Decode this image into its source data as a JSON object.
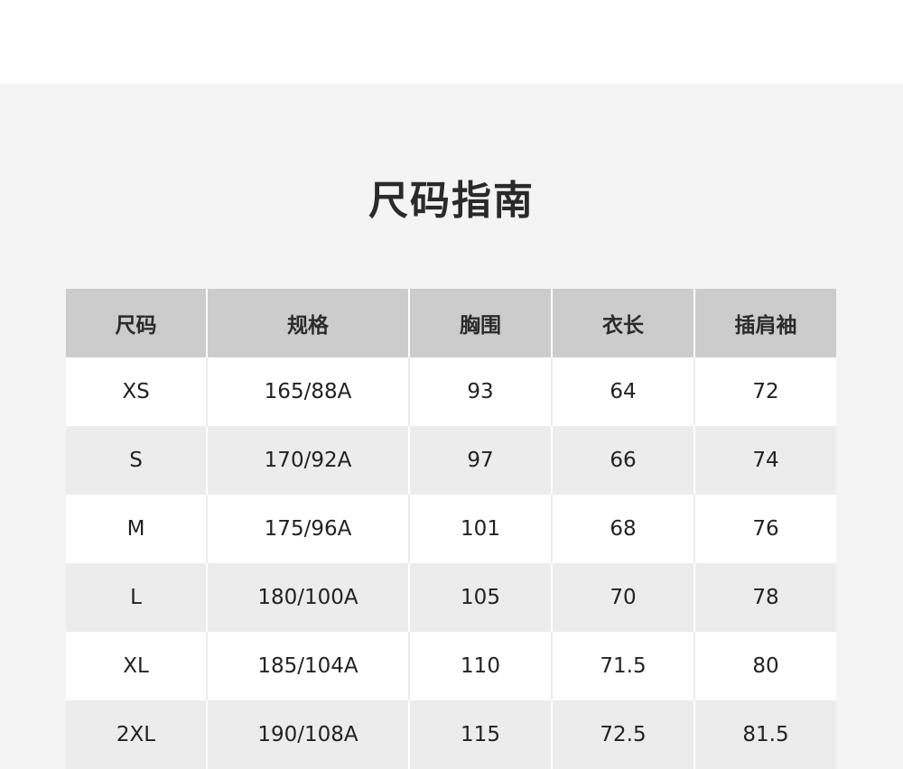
{
  "title": "尺码指南",
  "table": {
    "headers": [
      "尺码",
      "规格",
      "胸围",
      "衣长",
      "插肩袖"
    ],
    "rows": [
      [
        "XS",
        "165/88A",
        "93",
        "64",
        "72"
      ],
      [
        "S",
        "170/92A",
        "97",
        "66",
        "74"
      ],
      [
        "M",
        "175/96A",
        "101",
        "68",
        "76"
      ],
      [
        "L",
        "180/100A",
        "105",
        "70",
        "78"
      ],
      [
        "XL",
        "185/104A",
        "110",
        "71.5",
        "80"
      ],
      [
        "2XL",
        "190/108A",
        "115",
        "72.5",
        "81.5"
      ]
    ]
  },
  "colors": {
    "page_background": "#f4f4f4",
    "header_background": "#cccccc",
    "row_alt_background": "#ececec",
    "row_background": "#ffffff"
  }
}
